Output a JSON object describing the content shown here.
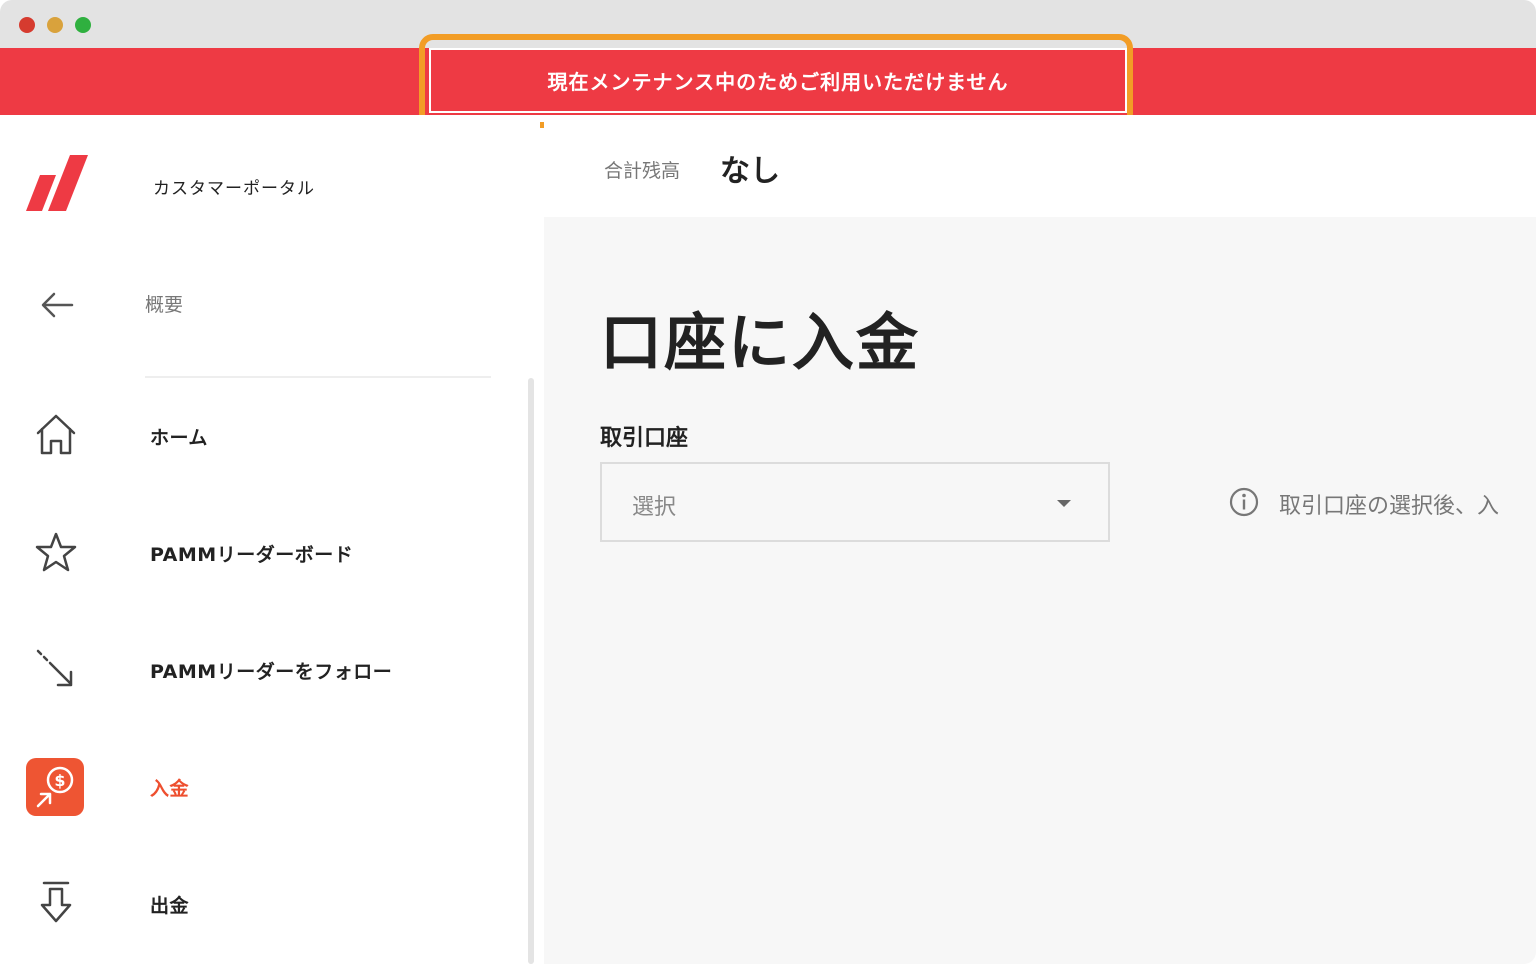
{
  "window": {
    "controls": [
      "close",
      "minimize",
      "maximize"
    ],
    "control_colors": {
      "close": "#d63b2f",
      "minimize": "#d9a23c",
      "maximize": "#2fb03f"
    }
  },
  "banner": {
    "message": "現在メンテナンス中のためご利用いただけません",
    "background": "#ee3a44",
    "highlight_color": "#f29d26"
  },
  "sidebar": {
    "brand_title": "カスタマーポータル",
    "brand_icon": "brand-logo-icon",
    "back_label": "概要",
    "items": [
      {
        "label": "ホーム",
        "icon": "home-icon",
        "active": false
      },
      {
        "label": "PAMMリーダーボード",
        "icon": "star-icon",
        "active": false
      },
      {
        "label": "PAMMリーダーをフォロー",
        "icon": "follow-arrow-icon",
        "active": false
      },
      {
        "label": "入金",
        "icon": "deposit-icon",
        "active": true
      },
      {
        "label": "出金",
        "icon": "withdraw-icon",
        "active": false
      }
    ],
    "accent_color": "#ee5533"
  },
  "header": {
    "balance_label": "合計残高",
    "balance_value": "なし"
  },
  "main": {
    "title": "口座に入金",
    "account_field": {
      "label": "取引口座",
      "selected": "選択"
    },
    "info_text": "取引口座の選択後、入"
  }
}
